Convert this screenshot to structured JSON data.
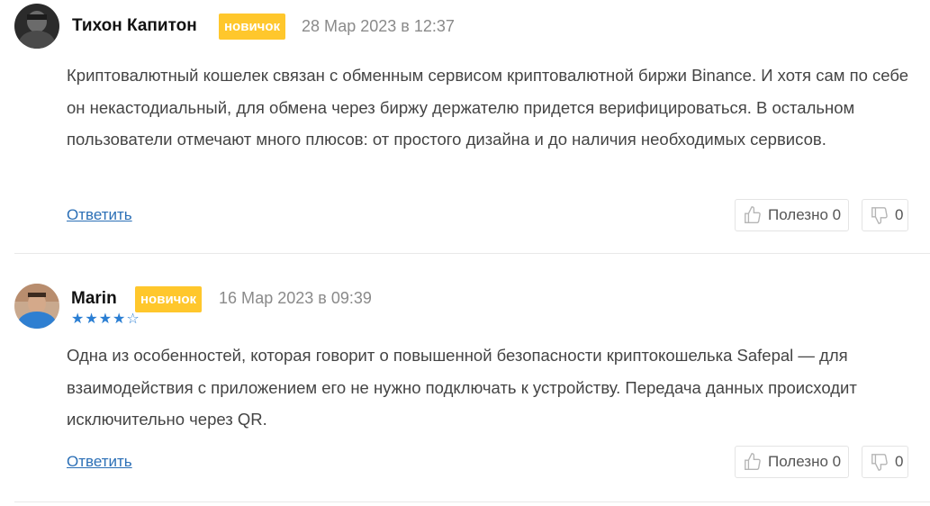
{
  "comments": [
    {
      "author": "Тихон Капитон",
      "badge": "новичок",
      "date": "28 Мар 2023 в 12:37",
      "text": "Криптовалютный кошелек связан с обменным сервисом криптовалютной биржи Binance. И хотя сам по себе он некастодиальный, для обмена через биржу держателю придется верифицироваться. В остальном пользователи отмечают много плюсов: от простого дизайна и до наличия необходимых сервисов.",
      "reply_label": "Ответить",
      "like_label": "Полезно 0",
      "dislike_label": "0"
    },
    {
      "author": "Marin",
      "badge": "новичок",
      "date": "16 Мар 2023 в 09:39",
      "rating": 4,
      "rating_max": 5,
      "text": "Одна из особенностей, которая говорит о повышенной безопасности криптокошелька Safepal — для взаимодействия с приложением его не нужно подключать к устройству. Передача данных происходит исключительно через QR.",
      "reply_label": "Ответить",
      "like_label": "Полезно 0",
      "dislike_label": "0"
    }
  ],
  "icons": {
    "like": "thumbs-up-icon",
    "dislike": "thumbs-down-icon",
    "star": "star-icon"
  },
  "colors": {
    "badge": "#ffc72c",
    "link": "#2b6fb6",
    "star": "#2a7ed3",
    "date": "#8a8a8a"
  }
}
